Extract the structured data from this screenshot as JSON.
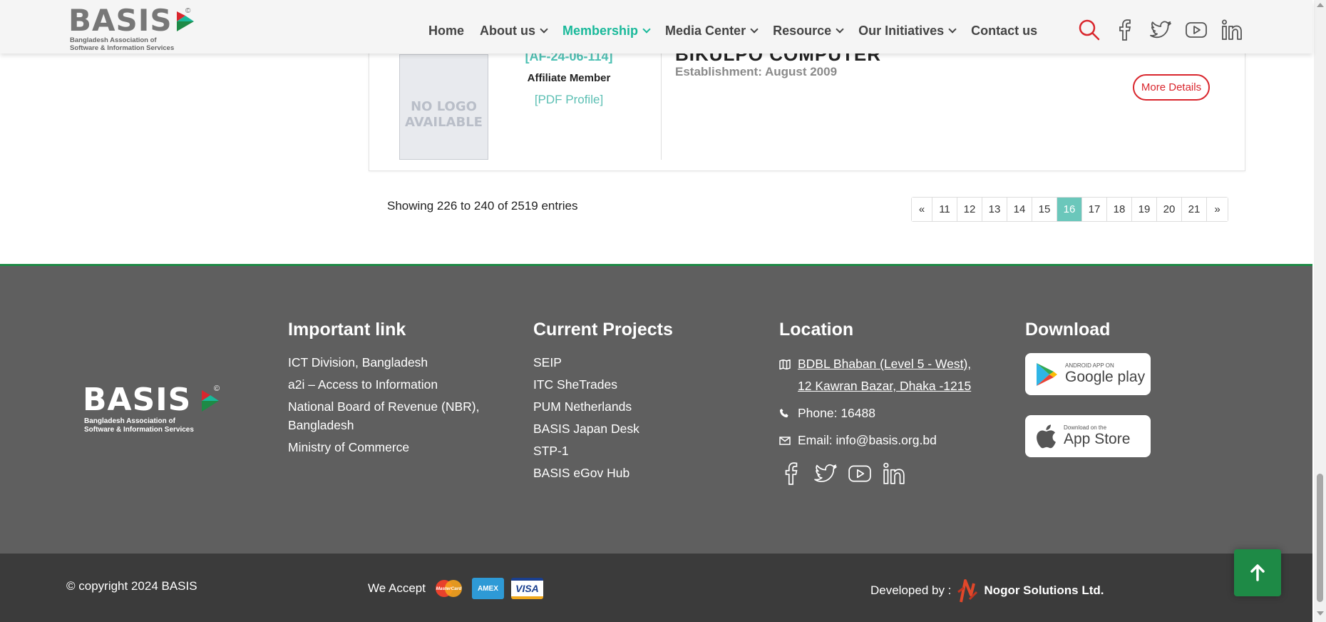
{
  "header": {
    "logo": {
      "word": "BASIS",
      "copyright": "©",
      "subtitle_1": "Bangladesh Association of",
      "subtitle_2": "Software & Information Services"
    },
    "nav": [
      {
        "label": "Home",
        "has_dropdown": false,
        "active": false
      },
      {
        "label": "About us",
        "has_dropdown": true,
        "active": false
      },
      {
        "label": "Membership",
        "has_dropdown": true,
        "active": true
      },
      {
        "label": "Media Center",
        "has_dropdown": true,
        "active": false
      },
      {
        "label": "Resource",
        "has_dropdown": true,
        "active": false
      },
      {
        "label": "Our Initiatives",
        "has_dropdown": true,
        "active": false
      },
      {
        "label": "Contact us",
        "has_dropdown": false,
        "active": false
      }
    ],
    "icons": [
      "search-icon",
      "facebook-icon",
      "twitter-icon",
      "youtube-icon",
      "linkedin-icon"
    ]
  },
  "member": {
    "logo_placeholder_line1": "NO LOGO",
    "logo_placeholder_line2": "AVAILABLE",
    "id": "[AF-24-06-114]",
    "type": "Affiliate Member",
    "pdf_link": "[PDF Profile]",
    "name": "BIKULPO COMPUTER",
    "establishment": "Establishment: August 2009",
    "more_details": "More Details"
  },
  "pagination": {
    "showing": "Showing 226 to 240 of 2519 entries",
    "prev": "«",
    "next": "»",
    "pages": [
      "11",
      "12",
      "13",
      "14",
      "15",
      "16",
      "17",
      "18",
      "19",
      "20",
      "21"
    ],
    "current": "16"
  },
  "footer": {
    "logo": {
      "word": "BASIS",
      "copyright": "©",
      "subtitle_1": "Bangladesh Association of",
      "subtitle_2": "Software & Information Services"
    },
    "important_links": {
      "title": "Important link",
      "items": [
        "ICT Division, Bangladesh",
        "a2i – Access to Information",
        "National Board of Revenue (NBR), Bangladesh",
        "Ministry of Commerce"
      ]
    },
    "projects": {
      "title": "Current Projects",
      "items": [
        "SEIP",
        "ITC SheTrades",
        "PUM Netherlands",
        "BASIS Japan Desk",
        "STP-1",
        "BASIS eGov Hub"
      ]
    },
    "location": {
      "title": "Location",
      "address_line1": "BDBL Bhaban (Level 5 - West),",
      "address_line2": "12 Kawran Bazar, Dhaka -1215",
      "phone": "Phone: 16488",
      "email": "Email: info@basis.org.bd"
    },
    "download": {
      "title": "Download",
      "google_small": "ANDROID APP ON",
      "google_big": "Google play",
      "apple_small": "Download on the",
      "apple_big": "App Store"
    }
  },
  "bottom": {
    "copyright": "© copyright 2024 BASIS",
    "we_accept": "We Accept",
    "cards": [
      "MasterCard",
      "AMEX",
      "VISA"
    ],
    "developed_by": "Developed by :",
    "developer": "Nogor Solutions Ltd."
  },
  "colors": {
    "accent": "#19b99a",
    "danger": "#d9262d",
    "footer_bg": "#5f5f5f",
    "bottom_bg": "#3b3b3b",
    "green": "#1e8a46"
  }
}
